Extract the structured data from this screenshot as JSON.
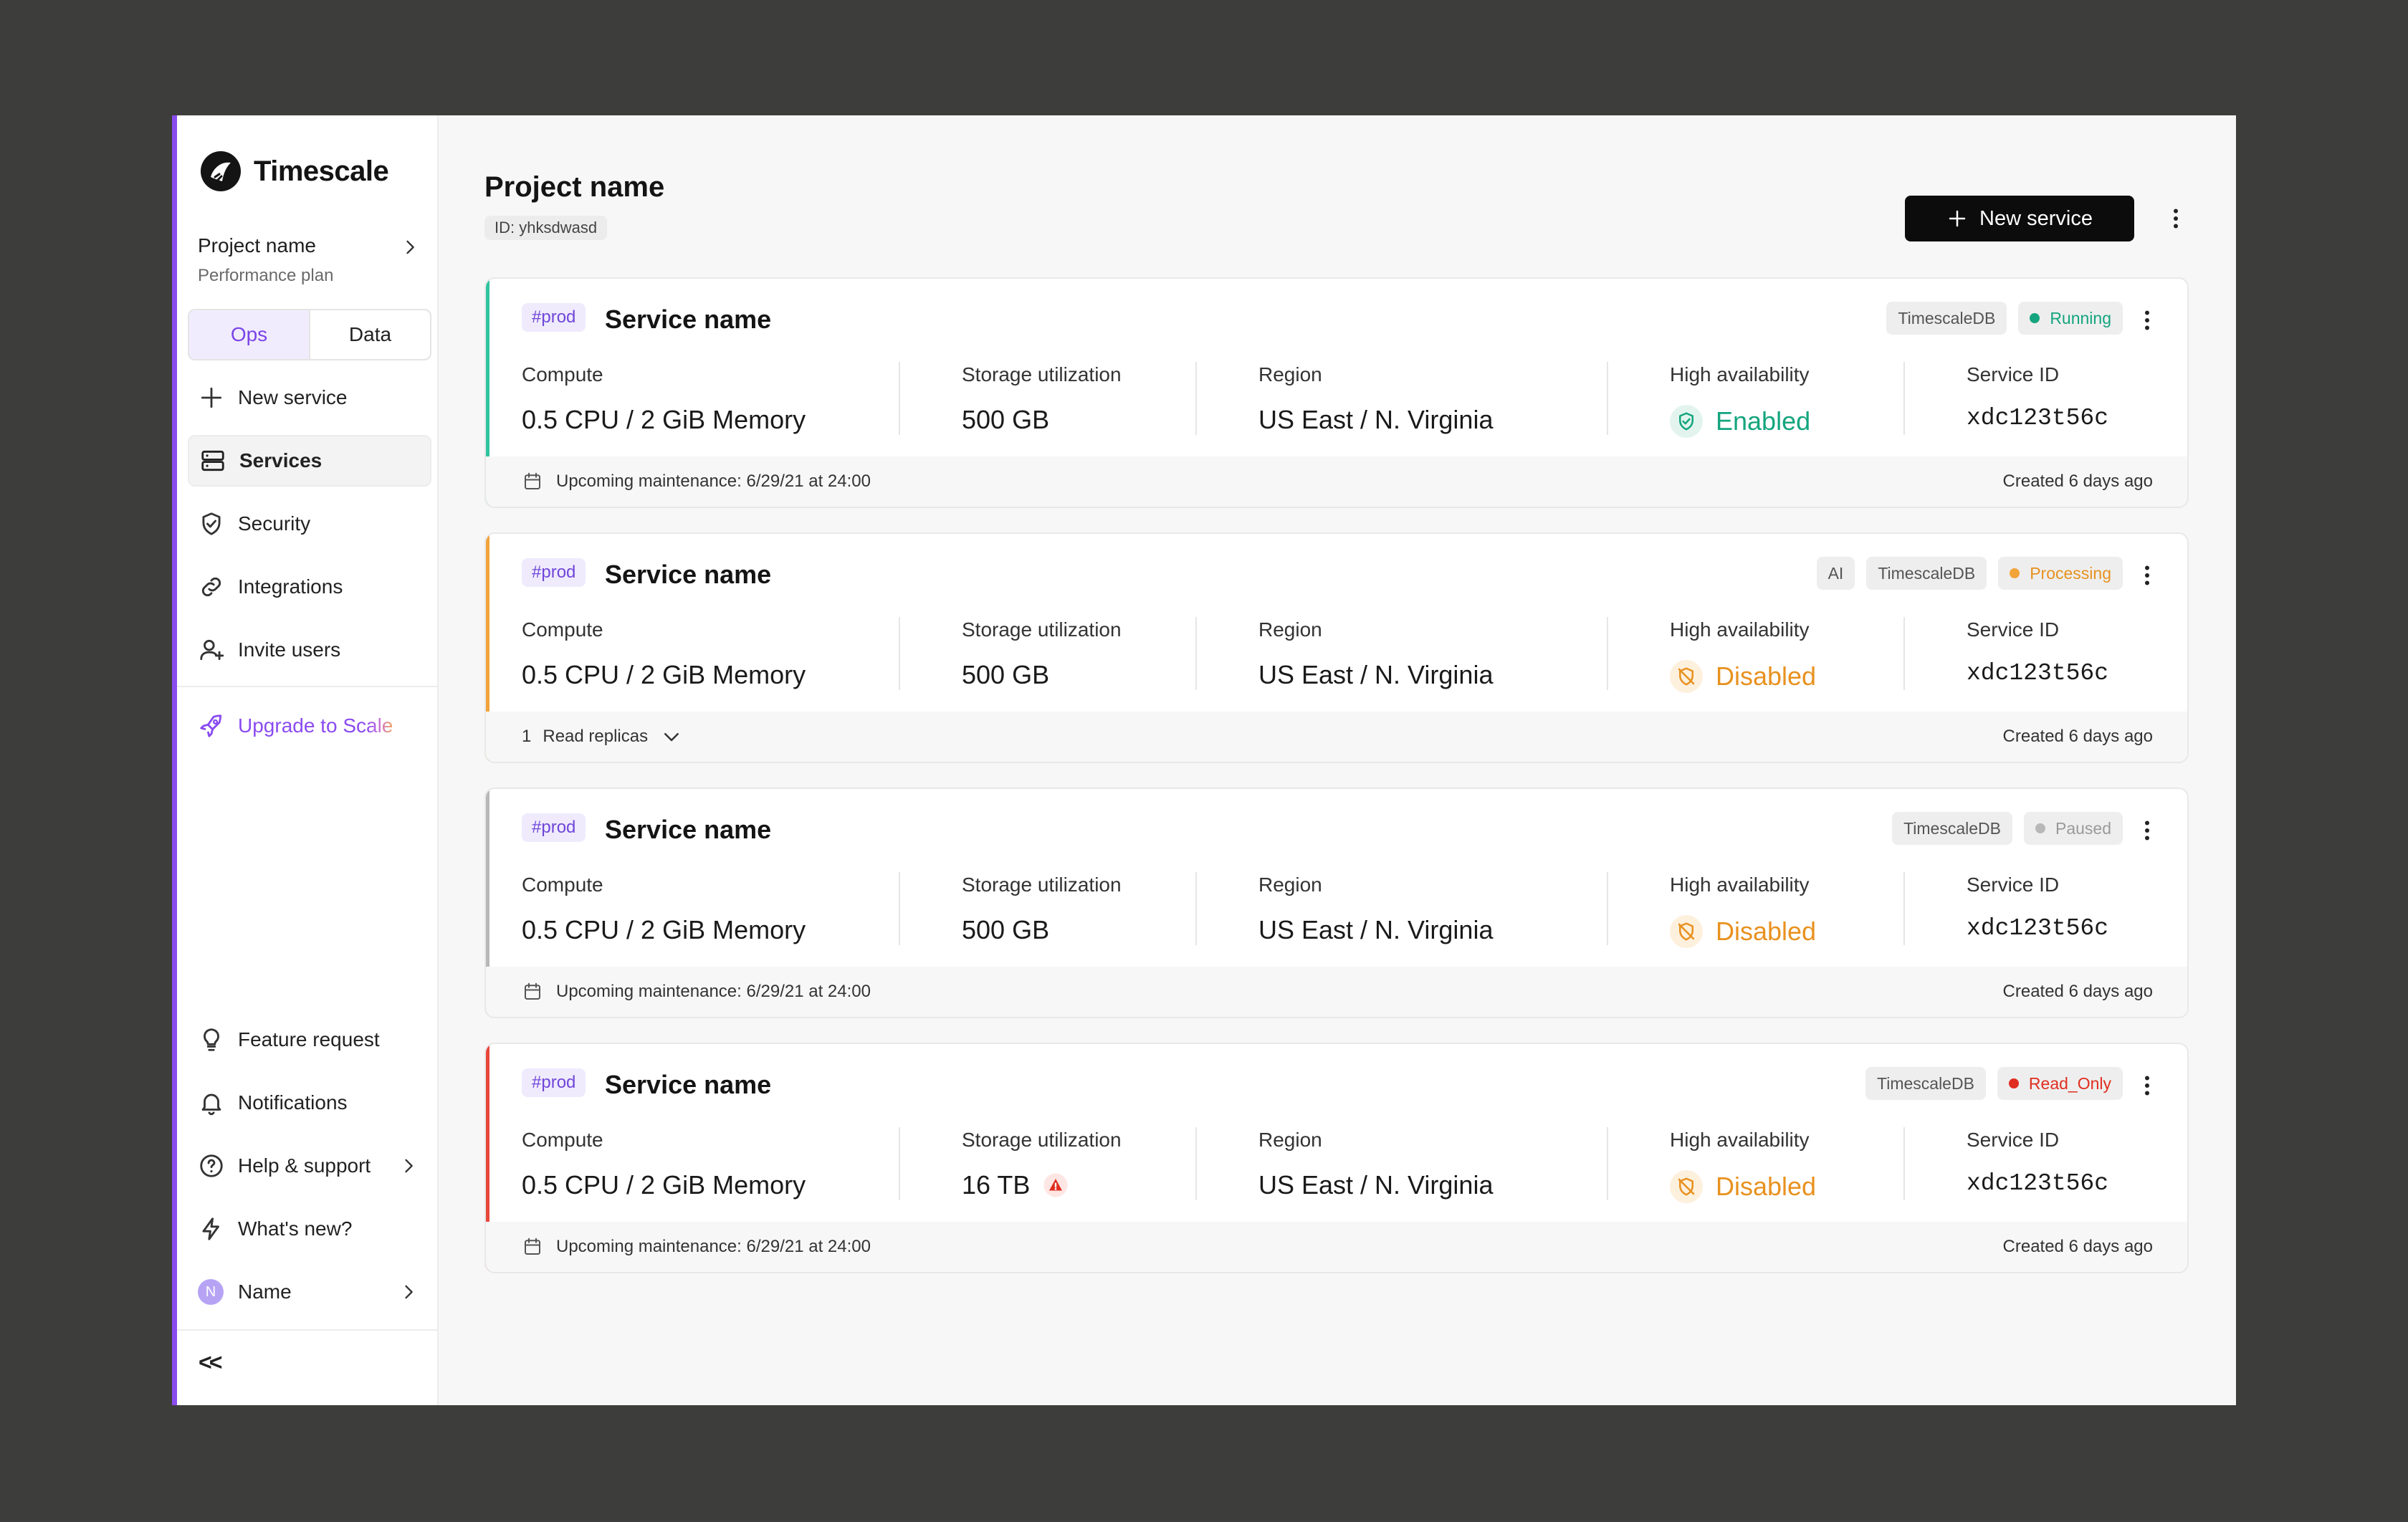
{
  "brand": {
    "name": "Timescale"
  },
  "project": {
    "name": "Project name",
    "plan": "Performance plan",
    "id_label": "ID: yhksdwasd"
  },
  "sidebar": {
    "tabs": [
      "Ops",
      "Data"
    ],
    "items": [
      {
        "label": "New service",
        "icon": "plus-icon"
      },
      {
        "label": "Services",
        "icon": "server-icon",
        "active": true
      },
      {
        "label": "Security",
        "icon": "shield-check-icon"
      },
      {
        "label": "Integrations",
        "icon": "link-icon"
      },
      {
        "label": "Invite users",
        "icon": "user-plus-icon"
      }
    ],
    "upgrade": {
      "label_a": "Upgrade to Sc",
      "label_b": "ale"
    },
    "bottom": [
      {
        "label": "Feature request",
        "icon": "lightbulb-icon"
      },
      {
        "label": "Notifications",
        "icon": "bell-icon"
      },
      {
        "label": "Help & support",
        "icon": "help-icon"
      },
      {
        "label": "What's new?",
        "icon": "lightning-icon"
      }
    ],
    "user": {
      "initial": "N",
      "name": "Name"
    },
    "collapse": "<<"
  },
  "header": {
    "title": "Project name",
    "new_service": "New service"
  },
  "labels": {
    "compute": "Compute",
    "storage": "Storage utilization",
    "region": "Region",
    "ha": "High availability",
    "service_id": "Service ID"
  },
  "colors": {
    "accent": "#8a4bf0",
    "running": "#14a57e",
    "processing": "#e8911f",
    "paused": "#b8b8b8",
    "read_only": "#e02e1f"
  },
  "services": [
    {
      "tag": "#prod",
      "name": "Service name",
      "badges": [
        "TimescaleDB"
      ],
      "status": "Running",
      "status_color": "#14a57e",
      "status_text_color": "#14a57e",
      "compute": "0.5 CPU / 2 GiB Memory",
      "storage": "500 GB",
      "storage_warning": false,
      "region": "US East / N. Virginia",
      "ha": "Enabled",
      "ha_ok": true,
      "service_id": "xdc123t56c",
      "footer_left": "Upcoming maintenance: 6/29/21 at 24:00",
      "footer_type": "maintenance",
      "created": "Created 6 days ago",
      "accent": "#2fc4a0"
    },
    {
      "tag": "#prod",
      "name": "Service name",
      "badges": [
        "AI",
        "TimescaleDB"
      ],
      "status": "Processing",
      "status_color": "#f2a33a",
      "status_text_color": "#e8911f",
      "compute": "0.5 CPU / 2 GiB Memory",
      "storage": "500 GB",
      "storage_warning": false,
      "region": "US East / N. Virginia",
      "ha": "Disabled",
      "ha_ok": false,
      "service_id": "xdc123t56c",
      "footer_count": "1",
      "footer_left": "Read replicas",
      "footer_type": "replicas",
      "created": "Created 6 days ago",
      "accent": "#f2a33a"
    },
    {
      "tag": "#prod",
      "name": "Service name",
      "badges": [
        "TimescaleDB"
      ],
      "status": "Paused",
      "status_color": "#b8b8b8",
      "status_text_color": "#9a9a9a",
      "compute": "0.5 CPU / 2 GiB Memory",
      "storage": "500 GB",
      "storage_warning": false,
      "region": "US East / N. Virginia",
      "ha": "Disabled",
      "ha_ok": false,
      "service_id": "xdc123t56c",
      "footer_left": "Upcoming maintenance: 6/29/21 at 24:00",
      "footer_type": "maintenance",
      "created": "Created 6 days ago",
      "accent": "#b8b8b8"
    },
    {
      "tag": "#prod",
      "name": "Service name",
      "badges": [
        "TimescaleDB"
      ],
      "status": "Read_Only",
      "status_color": "#e02e1f",
      "status_text_color": "#e02e1f",
      "compute": "0.5 CPU / 2 GiB Memory",
      "storage": "16 TB",
      "storage_warning": true,
      "region": "US East / N. Virginia",
      "ha": "Disabled",
      "ha_ok": false,
      "service_id": "xdc123t56c",
      "footer_left": "Upcoming maintenance: 6/29/21 at 24:00",
      "footer_type": "maintenance",
      "created": "Created 6 days ago",
      "accent": "#e8463a"
    }
  ]
}
